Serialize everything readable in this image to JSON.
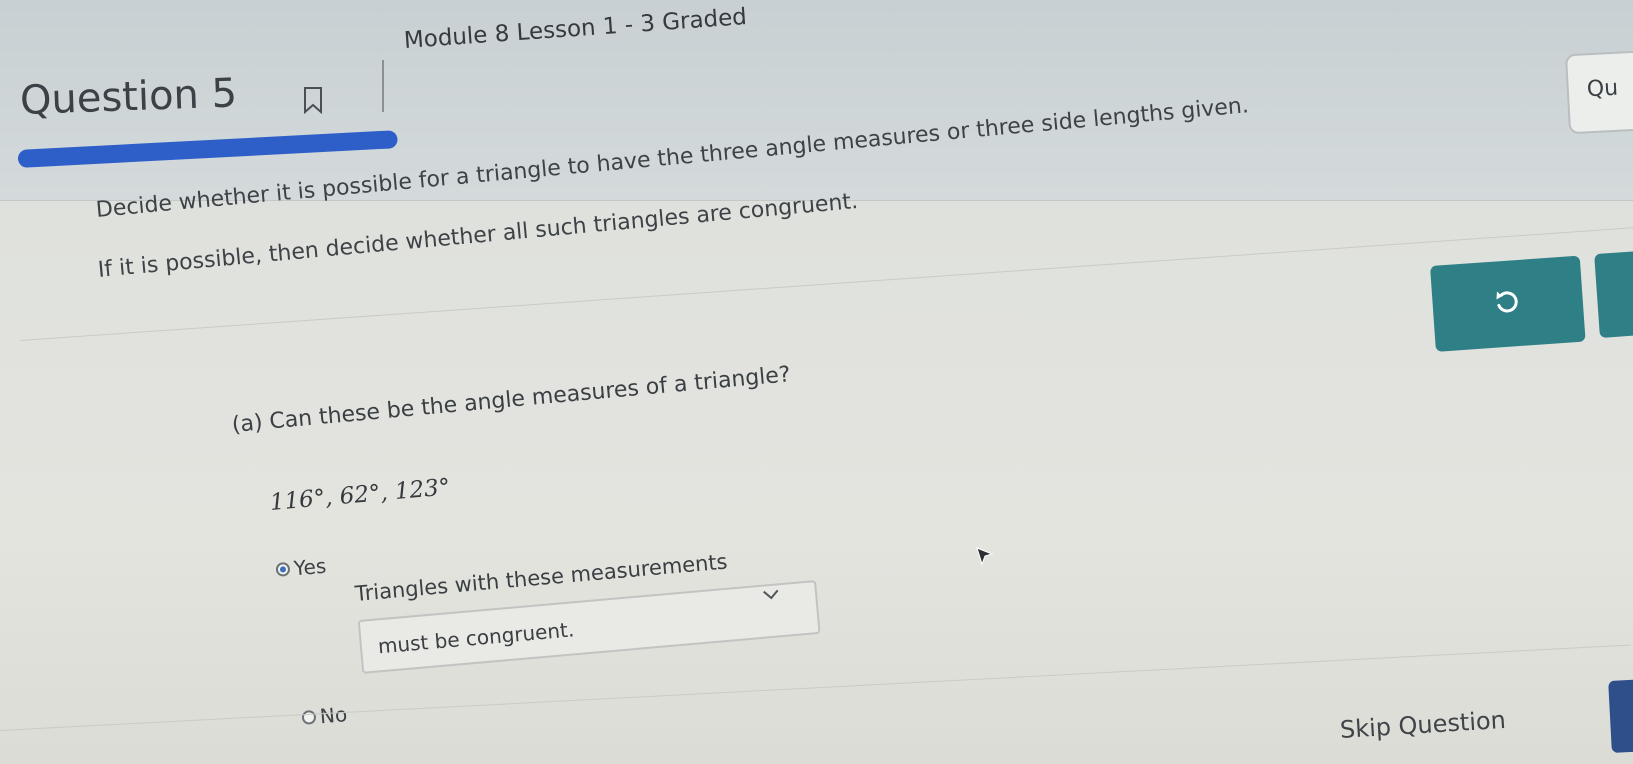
{
  "header": {
    "question_title": "Question 5",
    "module_label": "Module 8 Lesson 1 - 3 Graded",
    "side_tab_label": "Qu",
    "progress": 0.25
  },
  "prompt": {
    "line1": "Decide whether it is possible for a triangle to have the three angle measures or three side lengths given.",
    "line2": "If it is possible, then decide whether all such triangles are congruent."
  },
  "part_a": {
    "question": "(a) Can these be the angle measures of a triangle?",
    "angles": "116°, 62°, 123°",
    "options": {
      "yes": "Yes",
      "no": "No"
    },
    "selected": "yes",
    "sub_label": "Triangles with these measurements",
    "select_value": "must be congruent."
  },
  "footer": {
    "skip_label": "Skip Question"
  },
  "colors": {
    "accent_blue": "#2e5fc9",
    "teal_button": "#2f7f86"
  },
  "icons": [
    "bookmark-icon",
    "redo-icon",
    "chevron-down-icon",
    "mouse-cursor-icon"
  ]
}
